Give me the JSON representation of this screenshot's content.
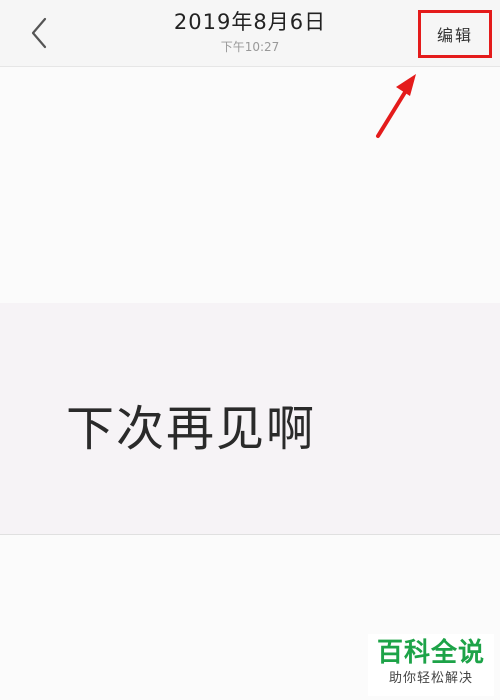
{
  "header": {
    "title": "2019年8月6日",
    "subtitle": "下午10:27",
    "edit_label": "编辑",
    "back_icon": "chevron-left-icon"
  },
  "note": {
    "text": "下次再见啊"
  },
  "annotation": {
    "highlight_color": "#e41b1b",
    "arrow_icon": "red-arrow-icon"
  },
  "watermark": {
    "main": "百科全说",
    "sub": "助你轻松解决",
    "color": "#1da348"
  }
}
